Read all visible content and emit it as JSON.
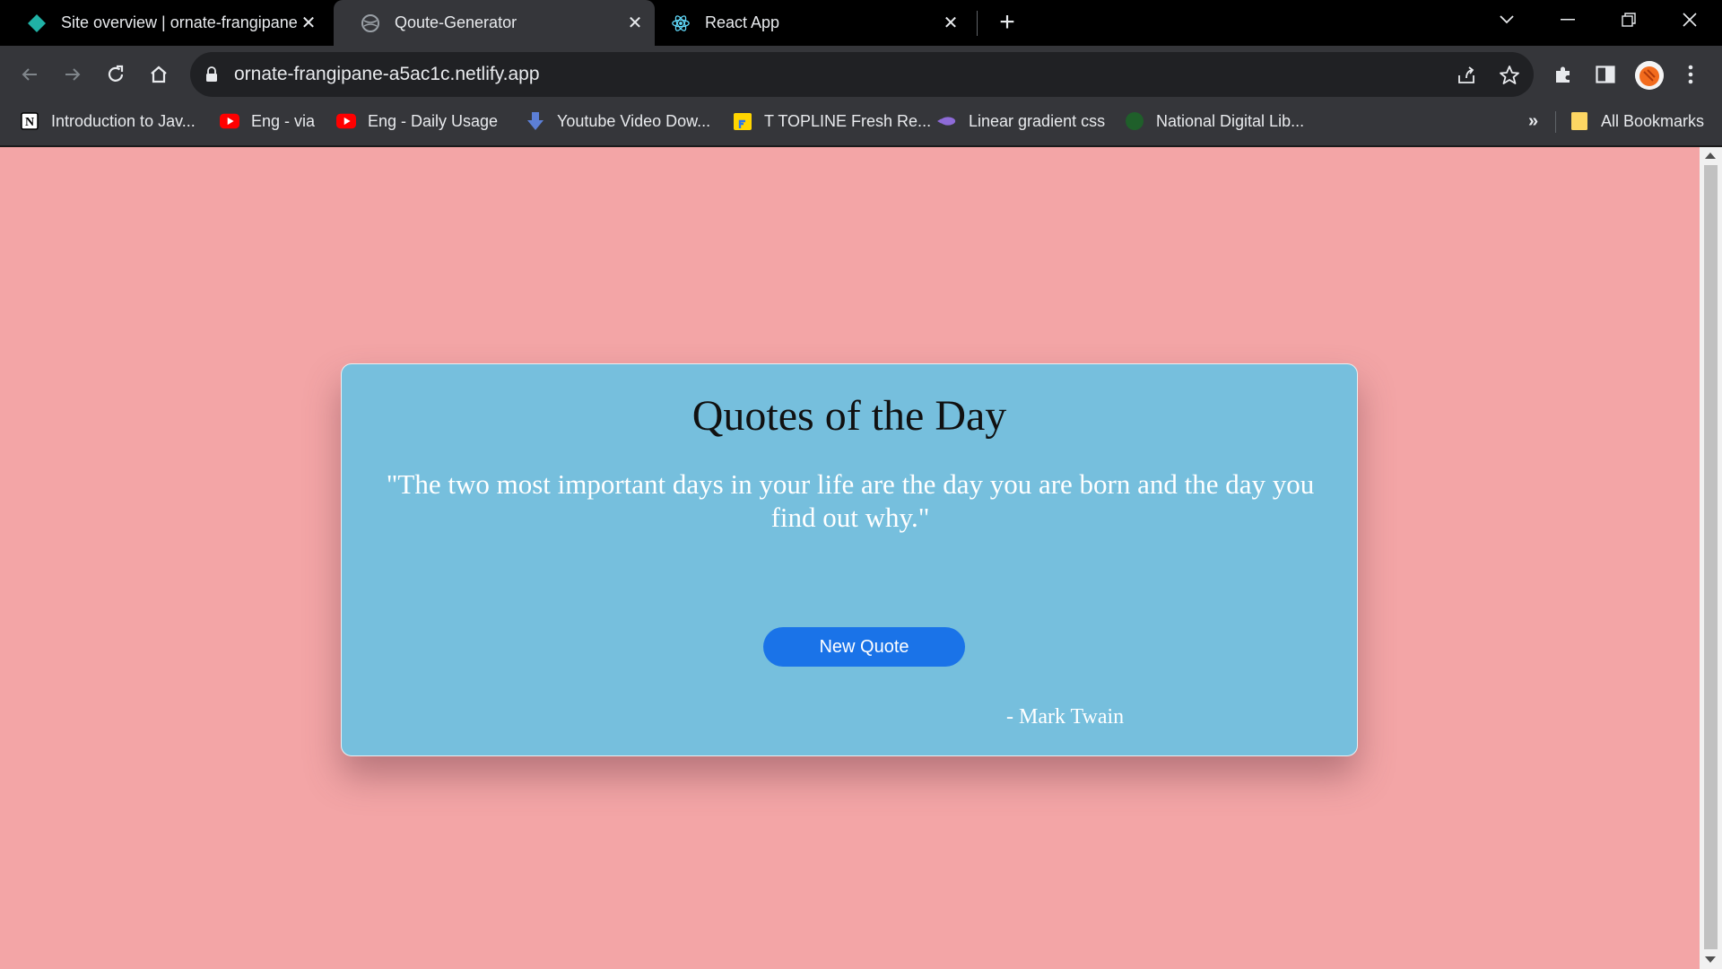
{
  "browser": {
    "tabs": [
      {
        "title": "Site overview | ornate-frangipane",
        "icon": "netlify-icon",
        "active": false
      },
      {
        "title": "Qoute-Generator",
        "icon": "globe-icon",
        "active": true
      },
      {
        "title": "React App",
        "icon": "react-icon",
        "active": false
      }
    ],
    "new_tab": "+",
    "address": "ornate-frangipane-a5ac1c.netlify.app",
    "bookmarks": [
      {
        "label": "Introduction to Jav...",
        "icon": "notion-icon"
      },
      {
        "label": "Eng - via",
        "icon": "youtube-icon"
      },
      {
        "label": "Eng -  Daily Usage",
        "icon": "youtube-icon"
      },
      {
        "label": "Youtube Video Dow...",
        "icon": "download-icon"
      },
      {
        "label": "T TOPLINE Fresh Re...",
        "icon": "flipkart-icon"
      },
      {
        "label": "Linear gradient css",
        "icon": "gradient-icon"
      },
      {
        "label": "National Digital Lib...",
        "icon": "library-icon"
      }
    ],
    "bookmarks_overflow": "»",
    "all_bookmarks": "All Bookmarks"
  },
  "app": {
    "title": "Quotes of the Day",
    "quote": "\"The two most important days in your life are the day you are born and the day you find out why.\"",
    "button_label": "New Quote",
    "author": "- Mark Twain"
  },
  "colors": {
    "page_background": "#f3a5a6",
    "card_background": "#76bfdd",
    "button": "#1a73e8"
  }
}
